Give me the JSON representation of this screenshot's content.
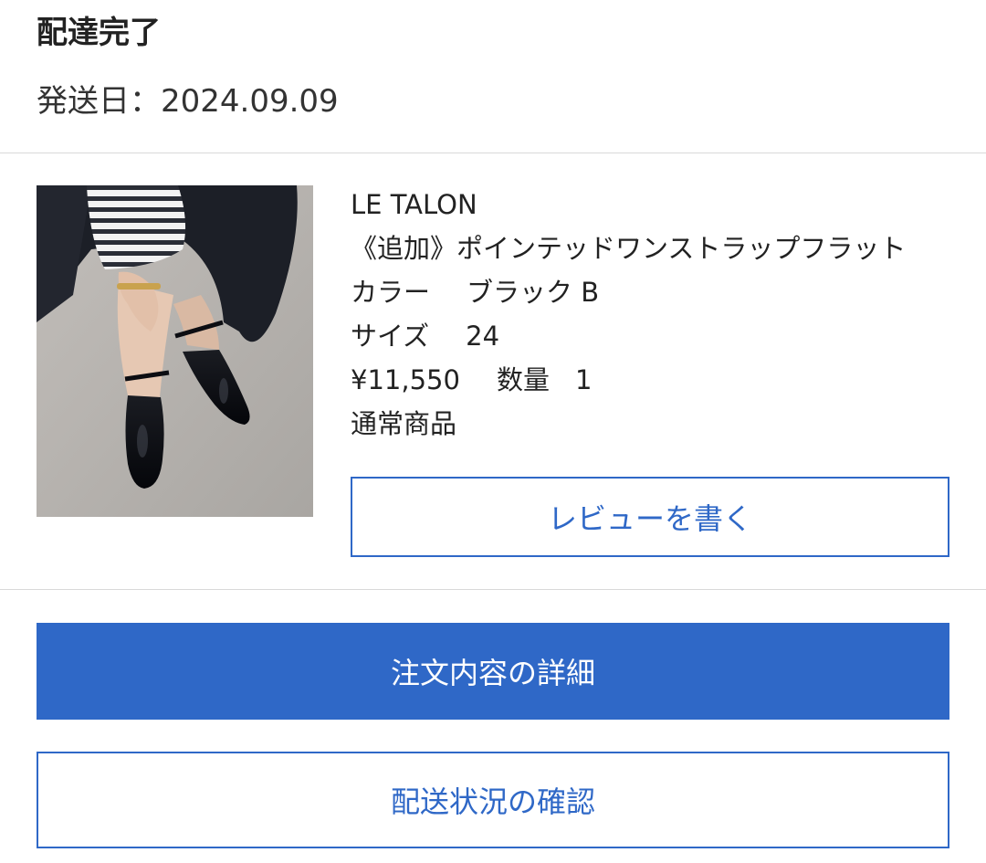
{
  "order": {
    "status": "配達完了",
    "ship_date_label": "発送日：",
    "ship_date": "2024.09.09"
  },
  "product": {
    "brand": "LE TALON",
    "name": "《追加》ポインテッドワンストラップフラット",
    "color_label": "カラー",
    "color_value": "ブラック B",
    "size_label": "サイズ",
    "size_value": "24",
    "price": "¥11,550",
    "quantity_label": "数量",
    "quantity_value": "1",
    "type": "通常商品",
    "review_button_label": "レビューを書く",
    "image_icon": "product-photo"
  },
  "actions": {
    "order_details_label": "注文内容の詳細",
    "delivery_status_label": "配送状況の確認"
  },
  "colors": {
    "accent": "#2f68c7",
    "divider": "#d9d9d9",
    "text": "#222222"
  }
}
